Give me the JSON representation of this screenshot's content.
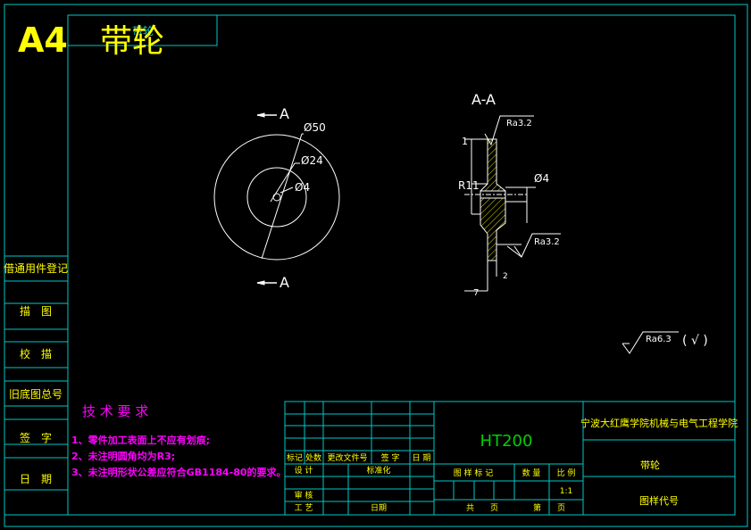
{
  "header": {
    "sheet_size": "A4",
    "part_name": "带轮",
    "tag": "带轮"
  },
  "colors": {
    "frame": "#00c8c8",
    "title": "#ffff00",
    "drawing": "#ffffff",
    "notes": "#ff00ff",
    "hatch": "#e0e000",
    "material": "#00d000"
  },
  "front_view": {
    "section_mark_top": "A",
    "section_mark_bottom": "A",
    "dim_outer": "Ø50",
    "dim_middle": "Ø24",
    "dim_bore": "Ø4"
  },
  "section_view": {
    "title": "A-A",
    "roughness_top": "Ra3.2",
    "roughness_side": "Ra3.2",
    "dim_1": "1",
    "dim_r": "R11",
    "dim_bore": "Ø4",
    "dim_2": "2",
    "dim_7": "7"
  },
  "general_roughness": {
    "label": "Ra6.3",
    "suffix": "( √ )"
  },
  "side_cells": [
    "借通用件登记",
    "描　图",
    "校　描",
    "旧底图总号",
    "签　字",
    "日　期"
  ],
  "notes": {
    "title": "技 术 要 求",
    "items": [
      "1、零件加工表面上不应有划痕;",
      "2、未注明圆角均为R3;",
      "3、未注明形状公差应符合GB1184-80的要求。"
    ]
  },
  "title_block": {
    "row_labels": [
      "标记",
      "处数",
      "更改文件号",
      "签 字",
      "日 期"
    ],
    "design": "设 计",
    "standardize": "标准化",
    "review": "审 核",
    "process": "工 艺",
    "date": "日期",
    "material": "HT200",
    "stage_mark": "图 样 标 记",
    "weight": "数 量",
    "scale": "比 例",
    "scale_value": "1:1",
    "sheets_total": "共　　页",
    "sheet_no": "第　　页",
    "school": "宁波大红鹰学院机械与电气工程学院",
    "part_name": "带轮",
    "drawing_no_label": "图样代号"
  }
}
